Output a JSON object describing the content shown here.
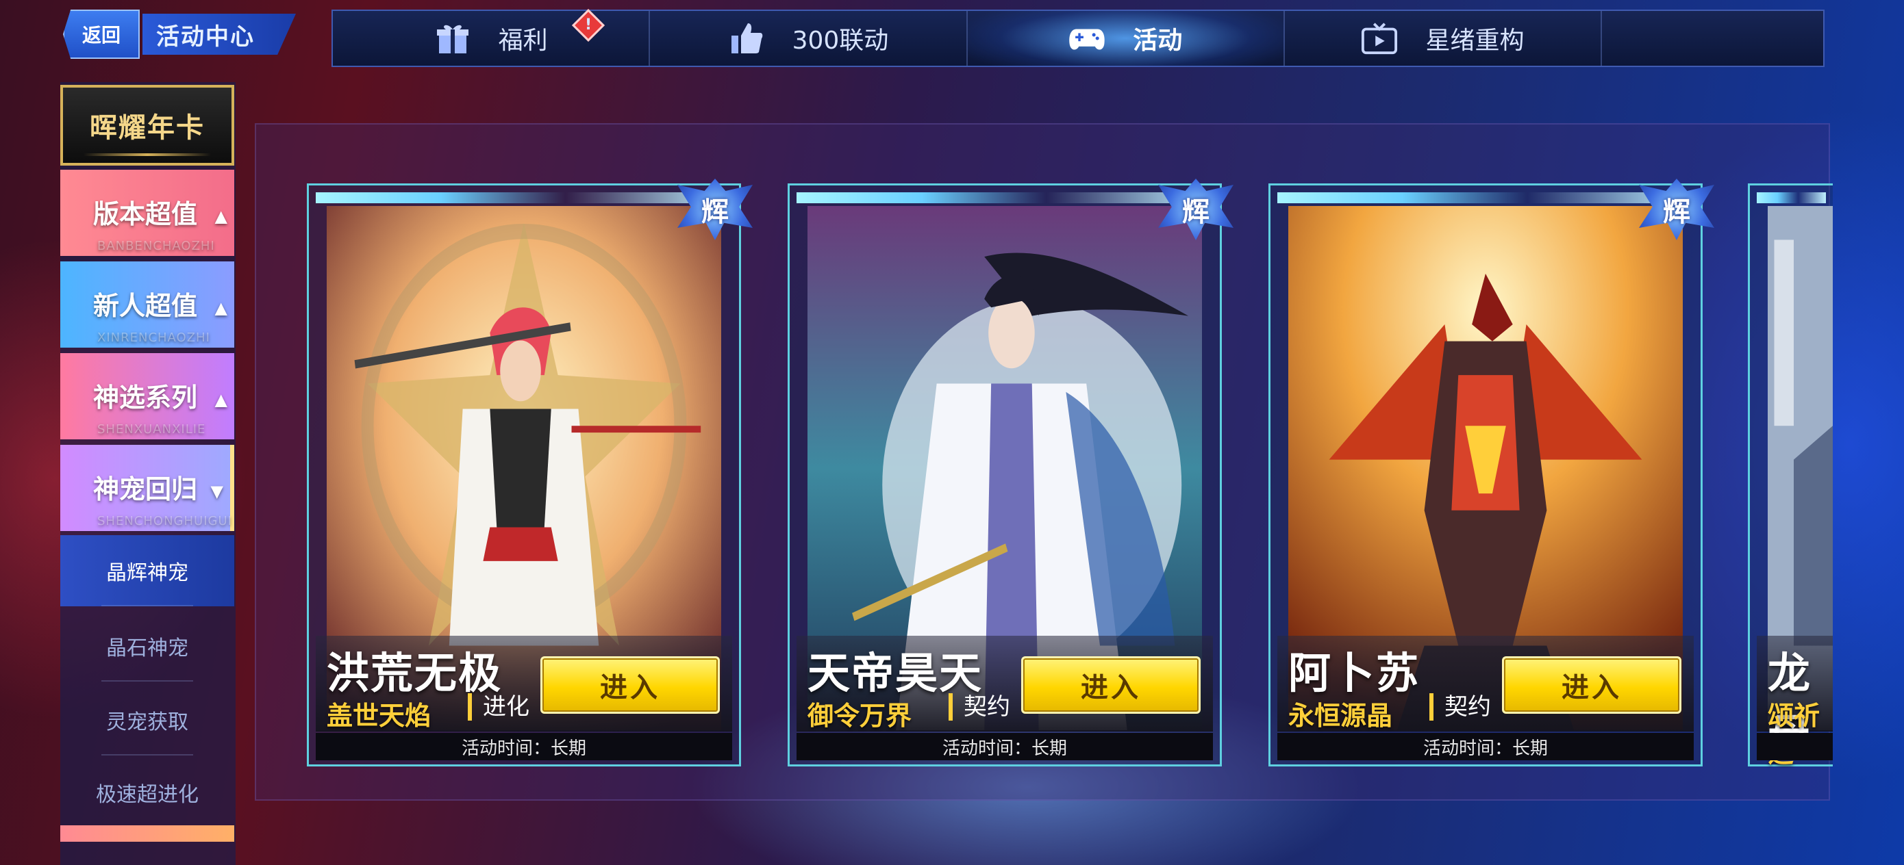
{
  "header": {
    "back_label": "返回",
    "title": "活动中心"
  },
  "topnav": {
    "tabs": [
      {
        "label": "福利",
        "icon": "gift-icon",
        "active": false,
        "alert": "!"
      },
      {
        "label": "300联动",
        "icon": "thumbs-up-icon",
        "active": false
      },
      {
        "label": "活动",
        "icon": "gamepad-icon",
        "active": true
      },
      {
        "label": "星绪重构",
        "icon": "tv-icon",
        "active": false
      }
    ]
  },
  "sidebar": {
    "annual_card": "晖耀年卡",
    "categories": [
      {
        "label": "版本超值",
        "sub": "BANBENCHAOZHI",
        "expanded": false
      },
      {
        "label": "新人超值",
        "sub": "XINRENCHAOZHI",
        "expanded": false
      },
      {
        "label": "神选系列",
        "sub": "SHENXUANXILIE",
        "expanded": false
      },
      {
        "label": "神宠回归",
        "sub": "SHENCHONGHUIGUI",
        "expanded": true
      }
    ],
    "subitems": [
      {
        "label": "晶辉神宠",
        "active": true
      },
      {
        "label": "晶石神宠",
        "active": false
      },
      {
        "label": "灵宠获取",
        "active": false
      },
      {
        "label": "极速超进化",
        "active": false
      }
    ]
  },
  "cards": [
    {
      "rank": "辉",
      "name": "洪荒无极",
      "skill": "盖世天焰",
      "type": "进化",
      "enter": "进入",
      "time": "活动时间：长期"
    },
    {
      "rank": "辉",
      "name": "天帝昊天",
      "skill": "御令万界",
      "type": "契约",
      "enter": "进入",
      "time": "活动时间：长期"
    },
    {
      "rank": "辉",
      "name": "阿卜苏",
      "skill": "永恒源晶",
      "type": "契约",
      "enter": "进入",
      "time": "活动时间：长期"
    },
    {
      "rank": "",
      "name": "龙母",
      "skill": "颂祈之",
      "type": "",
      "enter": "",
      "time": ""
    }
  ],
  "colors": {
    "accent_yellow": "#ffd600",
    "nav_bg": "#0c1638",
    "card_border": "#5fd0e0"
  }
}
